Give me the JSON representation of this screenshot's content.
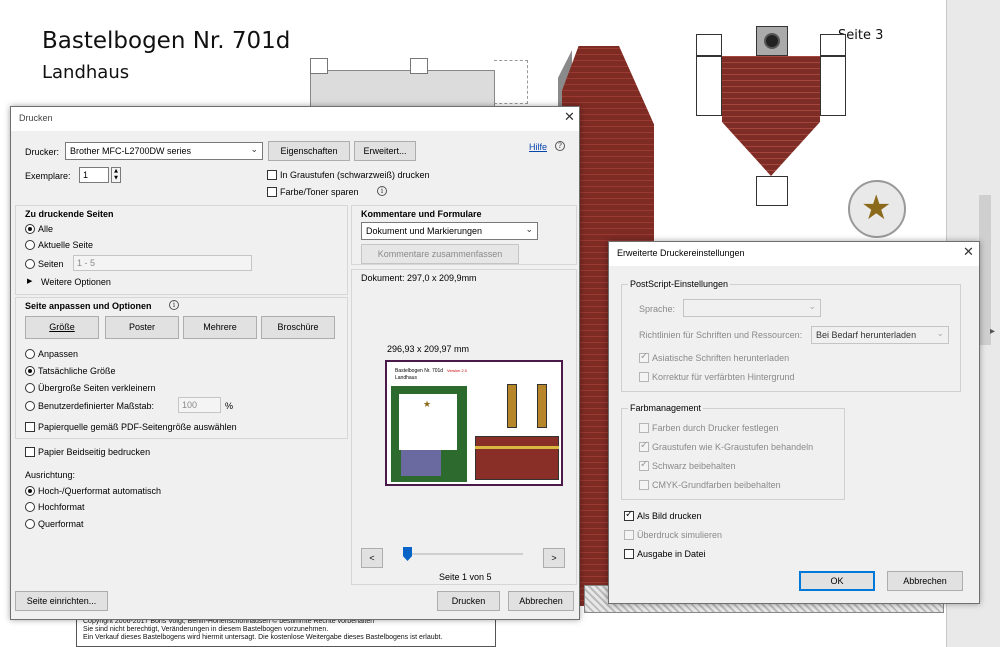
{
  "document": {
    "title": "Bastelbogen Nr. 701d",
    "subtitle": "Landhaus",
    "page_label": "Seite 3",
    "footer_lines": [
      "Copyright  2006-2017 Boris Voigt, Berlin-Hohenschönhausen     © bestimmte Rechte vorbehalten",
      "Sie sind nicht berechtigt, Veränderungen in diesem Bastelbogen vorzunehmen.",
      "Ein Verkauf dieses Bastelbogens wird hiermit untersagt. Die kostenlose Weitergabe dieses Bastelbogens ist erlaubt."
    ]
  },
  "print_dialog": {
    "title": "Drucken",
    "printer_label": "Drucker:",
    "printer_value": "Brother MFC-L2700DW series",
    "properties_button": "Eigenschaften",
    "advanced_button": "Erweitert...",
    "help_link": "Hilfe",
    "copies_label": "Exemplare:",
    "copies_value": "1",
    "grayscale_label": "In Graustufen (schwarzweiß) drucken",
    "grayscale_checked": false,
    "save_ink_label": "Farbe/Toner sparen",
    "save_ink_checked": false,
    "pages_section": {
      "title": "Zu druckende Seiten",
      "all": "Alle",
      "current": "Aktuelle Seite",
      "pages": "Seiten",
      "pages_value": "1 - 5",
      "more_options": "Weitere Optionen",
      "selected": "all"
    },
    "sizing_section": {
      "title": "Seite anpassen und Optionen",
      "tabs": [
        "Größe",
        "Poster",
        "Mehrere",
        "Broschüre"
      ],
      "options": [
        "Anpassen",
        "Tatsächliche Größe",
        "Übergroße Seiten verkleinern",
        "Benutzerdefinierter Maßstab:"
      ],
      "selected": "Tatsächliche Größe",
      "scale_value": "100",
      "scale_unit": "%",
      "paper_source_label": "Papierquelle gemäß PDF-Seitengröße auswählen",
      "paper_source_checked": false
    },
    "duplex_label": "Papier Beidseitig bedrucken",
    "duplex_checked": false,
    "orientation": {
      "title": "Ausrichtung:",
      "options": [
        "Hoch-/Querformat automatisch",
        "Hochformat",
        "Querformat"
      ],
      "selected": "Hoch-/Querformat automatisch"
    },
    "comments_section": {
      "title": "Kommentare und Formulare",
      "value": "Dokument und Markierungen",
      "summarize_button": "Kommentare zusammenfassen"
    },
    "document_size": "Dokument: 297,0 x 209,9mm",
    "preview_size": "296,93 x 209,97 mm",
    "preview_thumbnail": {
      "title": "Bastelbogen Nr. 701d",
      "subtitle": "Landhaus",
      "version": "Version 2.0"
    },
    "page_counter": "Seite 1 von 5",
    "prev_label": "<",
    "next_label": ">",
    "page_setup_button": "Seite einrichten...",
    "print_button": "Drucken",
    "cancel_button": "Abbrechen",
    "colors": {
      "slider": "#0a64c8",
      "preview_border": "#4a1a4a"
    }
  },
  "advanced_dialog": {
    "title": "Erweiterte Druckereinstellungen",
    "postscript_group": "PostScript-Einstellungen",
    "language_label": "Sprache:",
    "font_policy_label": "Richtlinien für Schriften und Ressourcen:",
    "font_policy_value": "Bei Bedarf herunterladen",
    "asian_fonts_label": "Asiatische Schriften herunterladen",
    "asian_fonts_checked": true,
    "discolored_bg_label": "Korrektur für verfärbten Hintergrund",
    "discolored_bg_checked": false,
    "color_mgmt_group": "Farbmanagement",
    "printer_colors_label": "Farben durch Drucker festlegen",
    "printer_colors_checked": false,
    "grayscale_k_label": "Graustufen wie K-Graustufen behandeln",
    "grayscale_k_checked": true,
    "keep_black_label": "Schwarz beibehalten",
    "keep_black_checked": true,
    "cmyk_label": "CMYK-Grundfarben beibehalten",
    "cmyk_checked": false,
    "as_image_label": "Als Bild drucken",
    "as_image_checked": true,
    "overprint_label": "Überdruck simulieren",
    "overprint_checked": false,
    "to_file_label": "Ausgabe in Datei",
    "to_file_checked": false,
    "ok_button": "OK",
    "cancel_button": "Abbrechen"
  }
}
